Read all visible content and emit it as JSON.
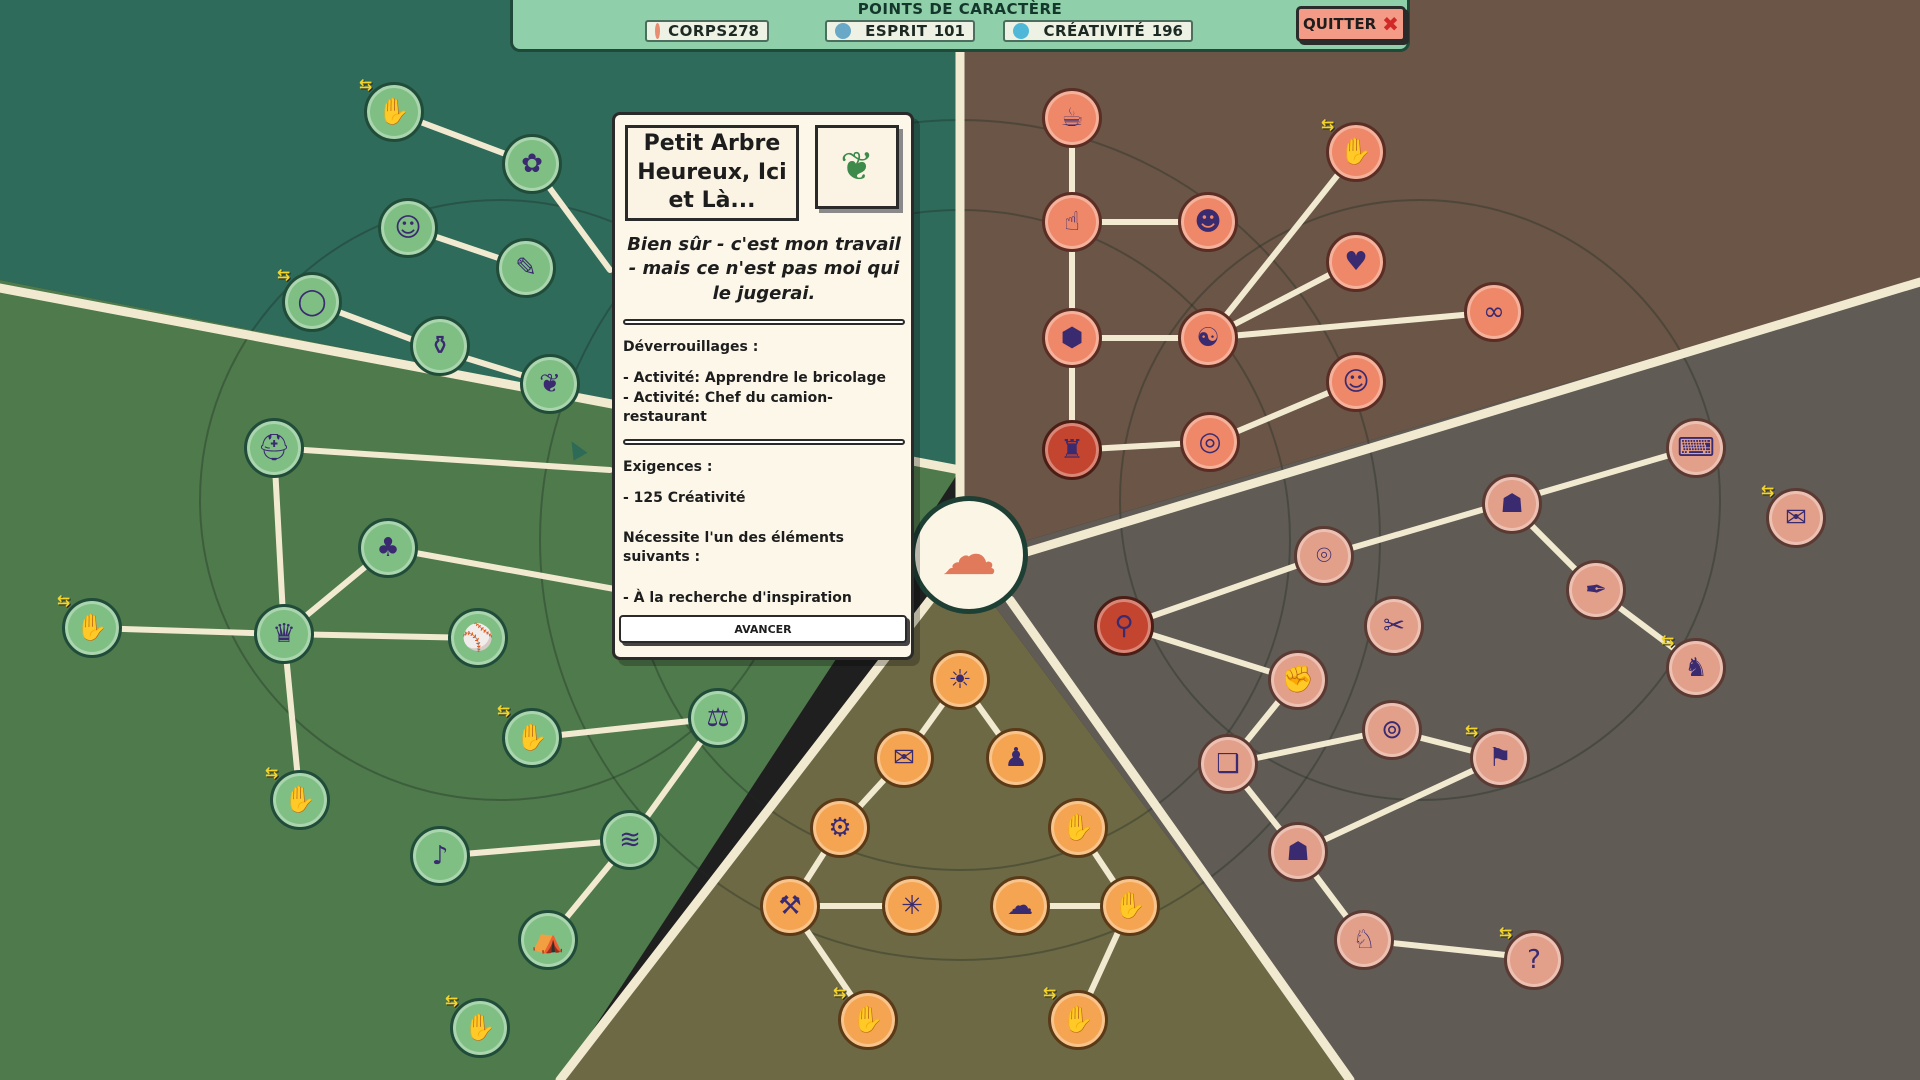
{
  "header": {
    "title": "POINTS DE CARACTÈRE",
    "stats": [
      {
        "label": "CORPS",
        "value": "278",
        "icon": "body-icon",
        "color": "#e88d72"
      },
      {
        "label": "ESPRIT",
        "value": "101",
        "icon": "mind-icon",
        "color": "#6aa8c8"
      },
      {
        "label": "CRÉATIVITÉ",
        "value": "196",
        "icon": "creativity-icon",
        "color": "#4fb8d8"
      }
    ],
    "quit_label": "QUITTER"
  },
  "tooltip": {
    "title": "Petit Arbre Heureux, Ici et Là...",
    "icon": "paintbrush-leaf-icon",
    "quote": "Bien sûr - c'est mon travail - mais ce n'est pas moi qui le jugerai.",
    "unlocks_heading": "Déverrouillages :",
    "unlocks": [
      "- Activité: Apprendre le bricolage",
      "- Activité: Chef du camion-restaurant"
    ],
    "requirements_heading": "Exigences :",
    "requirements": [
      "- 125 Créativité"
    ],
    "needs_one": "Nécessite l'un des éléments suivants :",
    "options": [
      "- À la recherche d'inspiration"
    ],
    "advance_label": "AVANCER"
  },
  "colors": {
    "green_region": "#2e6b5b",
    "olive_region": "#4f7a4c",
    "brown_region": "#6a5547",
    "grey_region": "#605b54",
    "khaki_region": "#6d6944",
    "branch": "#f1ead0"
  }
}
